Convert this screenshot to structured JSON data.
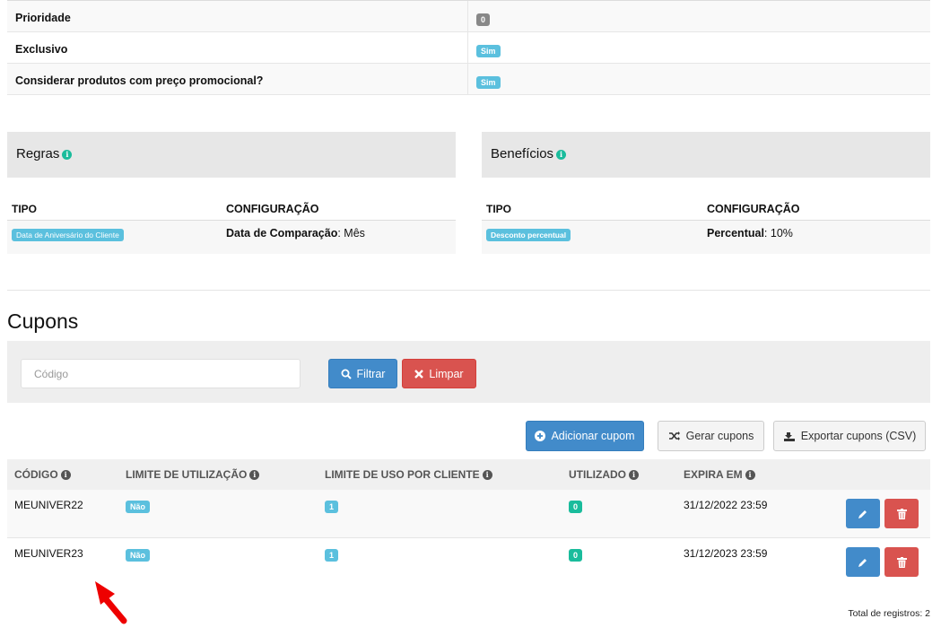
{
  "props": [
    {
      "label": "Prioridade",
      "value": "0",
      "color": "#888888"
    },
    {
      "label": "Exclusivo",
      "value": "Sim",
      "color": "#5bc0de"
    },
    {
      "label": "Considerar produtos com preço promocional?",
      "value": "Sim",
      "color": "#5bc0de"
    }
  ],
  "regras": {
    "title": "Regras",
    "col_tipo": "TIPO",
    "col_config": "CONFIGURAÇÃO",
    "row": {
      "tipo": "Data de Aniversário do Cliente",
      "config_key": "Data de Comparação",
      "config_value": ": Mês"
    }
  },
  "beneficios": {
    "title": "Benefícios",
    "col_tipo": "TIPO",
    "col_config": "CONFIGURAÇÃO",
    "row": {
      "tipo": "Desconto percentual",
      "config_key": "Percentual",
      "config_value": ": 10%"
    }
  },
  "cupons": {
    "title": "Cupons",
    "filter": {
      "placeholder": "Código",
      "filter_label": "Filtrar",
      "clear_label": "Limpar"
    },
    "actions": {
      "add": "Adicionar cupom",
      "generate": "Gerar cupons",
      "export": "Exportar cupons (CSV)"
    },
    "columns": [
      "CÓDIGO",
      "LIMITE DE UTILIZAÇÃO",
      "LIMITE DE USO POR CLIENTE",
      "UTILIZADO",
      "EXPIRA EM"
    ],
    "rows": [
      {
        "codigo": "MEUNIVER22",
        "limite": "Não",
        "limite_cliente": "1",
        "utilizado": "0",
        "expira": "31/12/2022 23:59"
      },
      {
        "codigo": "MEUNIVER23",
        "limite": "Não",
        "limite_cliente": "1",
        "utilizado": "0",
        "expira": "31/12/2023 23:59"
      }
    ],
    "total": "Total de registros: 2"
  },
  "colors": {
    "primary": "#428bca",
    "danger": "#d9534f",
    "info": "#5bc0de",
    "success": "#1abc9c"
  }
}
